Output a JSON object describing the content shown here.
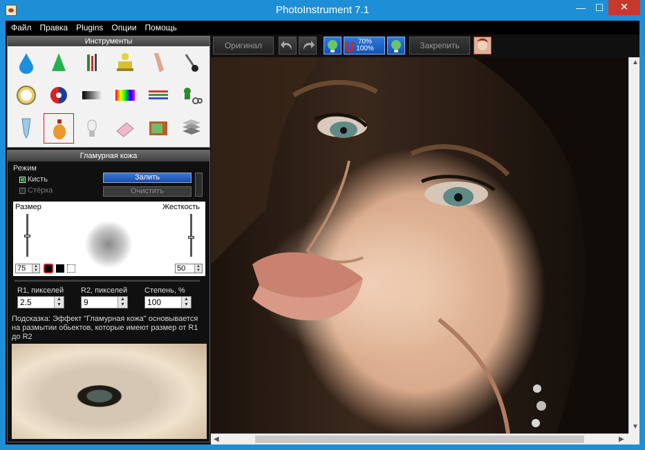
{
  "window": {
    "title": "PhotoInstrument 7.1",
    "min_glyph": "—",
    "max_glyph": "☐",
    "close_glyph": "✕"
  },
  "menu": [
    "Файл",
    "Правка",
    "Plugins",
    "Опции",
    "Помощь"
  ],
  "tools_panel": {
    "title": "Инструменты",
    "tools": [
      "drop-icon",
      "cone-icon",
      "brushes-icon",
      "stamp-icon",
      "finger-icon",
      "pin-icon",
      "clock-icon",
      "color-wheel-icon",
      "gradient-icon",
      "rainbow-icon",
      "lines-icon",
      "clone-scissors-icon",
      "tube-icon",
      "glamour-bottle-icon",
      "lamp-icon",
      "eraser-icon",
      "tv-icon",
      "text-layers-icon"
    ],
    "selected_index": 13
  },
  "glamour_panel": {
    "title": "Гламурная кожа",
    "mode_label": "Режим",
    "brush_label": "Кисть",
    "brush_checked": true,
    "eraser_label": "Стёрка",
    "eraser_checked": false,
    "fill_button": "Залить",
    "clear_button": "Очистить",
    "size_label": "Размер",
    "hardness_label": "Жесткость",
    "size_value": "75",
    "hardness_value": "50",
    "r1_label": "R1, пикселей",
    "r1_value": "2.5",
    "r2_label": "R2, пикселей",
    "r2_value": "9",
    "degree_label": "Степень, %",
    "degree_value": "100",
    "hint": "Подсказка: Эффект \"Гламурная кожа\" основывается на размытии обьектов, которые имеют размер от R1 до R2"
  },
  "toolbar": {
    "original_button": "Оригинал",
    "pin_button": "Закрепить",
    "zoom_top": "70%",
    "zoom_bottom": "100%"
  },
  "colors": {
    "accent": "#1e8fd6",
    "close": "#c7392b",
    "selected_tool": "#e0141e"
  }
}
